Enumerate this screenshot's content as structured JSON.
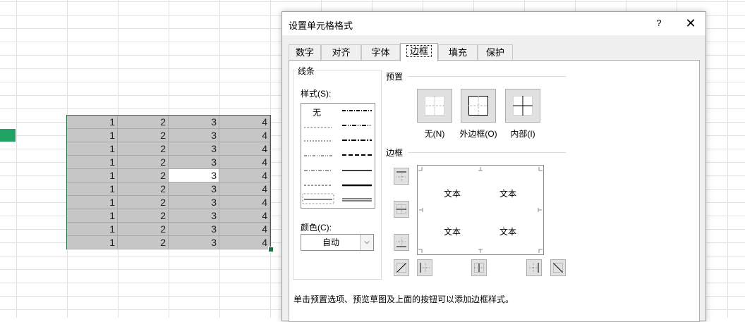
{
  "sheet": {
    "rows": [
      [
        "1",
        "2",
        "3",
        "4"
      ],
      [
        "1",
        "2",
        "3",
        "4"
      ],
      [
        "1",
        "2",
        "3",
        "4"
      ],
      [
        "1",
        "2",
        "3",
        "4"
      ],
      [
        "1",
        "2",
        "3",
        "4"
      ],
      [
        "1",
        "2",
        "3",
        "4"
      ],
      [
        "1",
        "2",
        "3",
        "4"
      ],
      [
        "1",
        "2",
        "3",
        "4"
      ],
      [
        "1",
        "2",
        "3",
        "4"
      ],
      [
        "1",
        "2",
        "3",
        "4"
      ]
    ],
    "selection_color": "#c6c6c6",
    "accent": "#217346"
  },
  "dialog": {
    "title": "设置单元格格式",
    "help": "?",
    "close": "✕",
    "tabs": [
      {
        "label": "数字"
      },
      {
        "label": "对齐"
      },
      {
        "label": "字体"
      },
      {
        "label": "边框",
        "active": true
      },
      {
        "label": "填充"
      },
      {
        "label": "保护"
      }
    ],
    "line": {
      "group_label": "线条",
      "style_label": "样式(S):",
      "style_none": "无",
      "color_label": "颜色(C):",
      "color_value": "自动"
    },
    "presets": {
      "group_label": "预置",
      "none": "无(N)",
      "outline": "外边框(O)",
      "inside": "内部(I)"
    },
    "border": {
      "group_label": "边框",
      "preview_text": [
        "文本",
        "文本",
        "文本",
        "文本"
      ]
    },
    "hint": "单击预置选项、预览草图及上面的按钮可以添加边框样式。"
  }
}
